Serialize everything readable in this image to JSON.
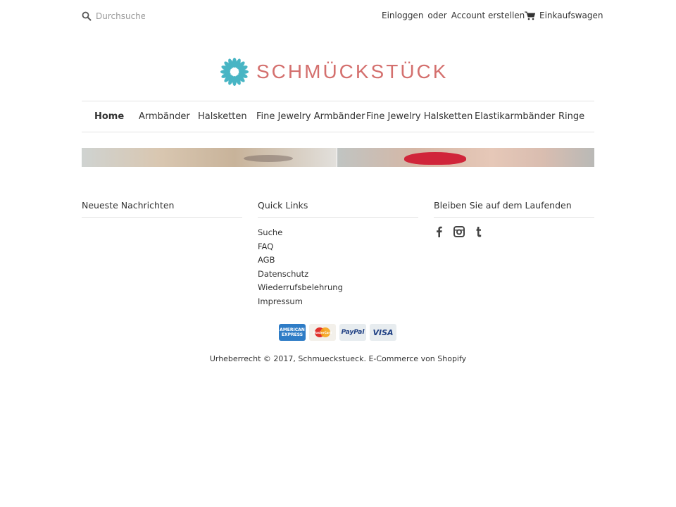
{
  "header": {
    "search_placeholder": "Durchsuchen",
    "login": "Einloggen",
    "or": "oder",
    "create_account": "Account erstellen",
    "cart": "Einkaufswagen"
  },
  "logo": {
    "text": "SCHMÜCKSTÜCK",
    "color": "#d4706e",
    "flower_color": "#48b5c4"
  },
  "nav": {
    "items": [
      {
        "label": "Home",
        "active": true
      },
      {
        "label": "Armbänder"
      },
      {
        "label": "Halsketten"
      },
      {
        "label": "Fine Jewelry Armbänder"
      },
      {
        "label": "Fine Jewelry Halsketten"
      },
      {
        "label": "Elastikarmbänder"
      },
      {
        "label": "Ringe"
      }
    ]
  },
  "footer": {
    "news_title": "Neueste Nachrichten",
    "links_title": "Quick Links",
    "links": [
      "Suche",
      "FAQ",
      "AGB",
      "Datenschutz",
      "Wiederrufsbelehrung",
      "Impressum"
    ],
    "social_title": "Bleiben Sie auf dem Laufenden",
    "social_icons": [
      "facebook-icon",
      "instagram-icon",
      "tumblr-icon"
    ],
    "payments": {
      "amex": "AMERICAN EXPRESS",
      "mastercard": "MasterCard",
      "paypal": "PayPal",
      "visa": "VISA"
    },
    "copyright": "Urheberrecht © 2017, Schmueckstueck. E-Commerce von Shopify"
  }
}
